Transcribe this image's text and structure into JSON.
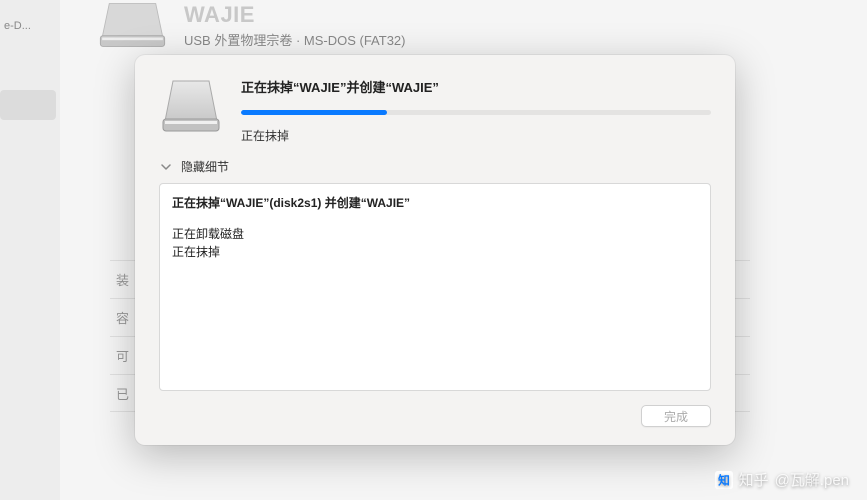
{
  "background": {
    "sidebar_label": "e-D...",
    "disk_title": "WAJIE",
    "disk_subtitle": "USB 外置物理宗卷 · MS-DOS (FAT32)",
    "info_rows": [
      "装",
      "容",
      "可",
      "已"
    ]
  },
  "modal": {
    "title": "正在抹掉“WAJIE”并创建“WAJIE”",
    "progress_percent": 31,
    "status": "正在抹掉",
    "details_toggle_label": "隐藏细节",
    "details": {
      "heading": "正在抹掉“WAJIE”(disk2s1) 并创建“WAJIE”",
      "lines": [
        "正在卸载磁盘",
        "正在抹掉"
      ]
    },
    "done_button": "完成",
    "done_enabled": false
  },
  "watermark": {
    "brand": "知乎",
    "user": "@瓦解.pen"
  },
  "colors": {
    "accent": "#0a7aff",
    "modal_bg": "#f4f3f2"
  }
}
